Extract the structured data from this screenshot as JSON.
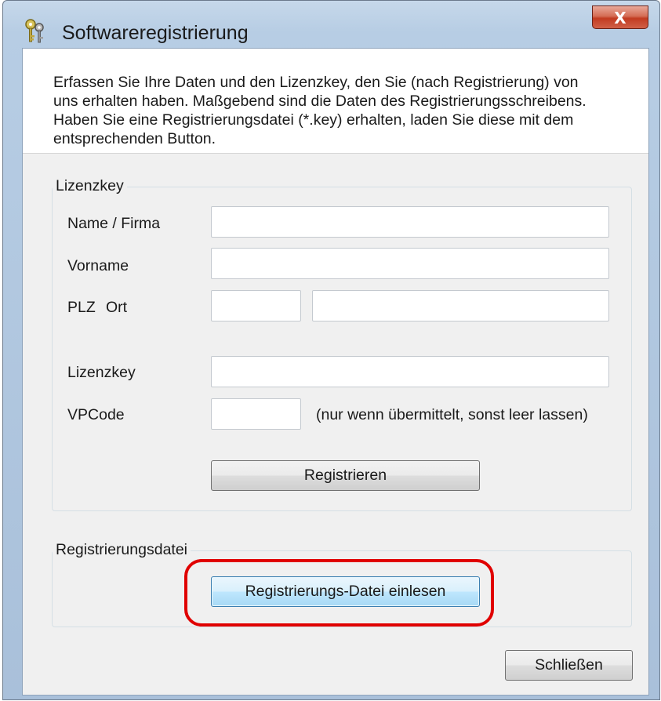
{
  "window": {
    "title": "Softwareregistrierung",
    "close_glyph": "X",
    "icon": "keys-icon"
  },
  "info": {
    "text_line1": "Erfassen Sie Ihre Daten und den Lizenzkey, den Sie (nach Registrierung) von",
    "text_line2": "uns erhalten haben. Maßgebend sind die Daten des Registrierungsschreibens.",
    "text_line3": "Haben Sie eine Registrierungsdatei (*.key) erhalten, laden Sie diese mit dem",
    "text_line4": "entsprechenden Button."
  },
  "license_group": {
    "title": "Lizenzkey",
    "name_label": "Name / Firma",
    "name_value": "",
    "firstname_label": "Vorname",
    "firstname_value": "",
    "plz_label": "PLZ",
    "ort_label": "Ort",
    "plz_value": "",
    "ort_value": "",
    "licensekey_label": "Lizenzkey",
    "licensekey_value": "",
    "vpcode_label": "VPCode",
    "vpcode_value": "",
    "vpcode_hint": "(nur wenn übermittelt, sonst leer lassen)",
    "register_button": "Registrieren"
  },
  "file_group": {
    "title": "Registrierungsdatei",
    "load_button": "Registrierungs-Datei einlesen"
  },
  "footer": {
    "close_button": "Schließen"
  },
  "colors": {
    "highlight": "#e00000",
    "close_button": "#c23b21"
  }
}
